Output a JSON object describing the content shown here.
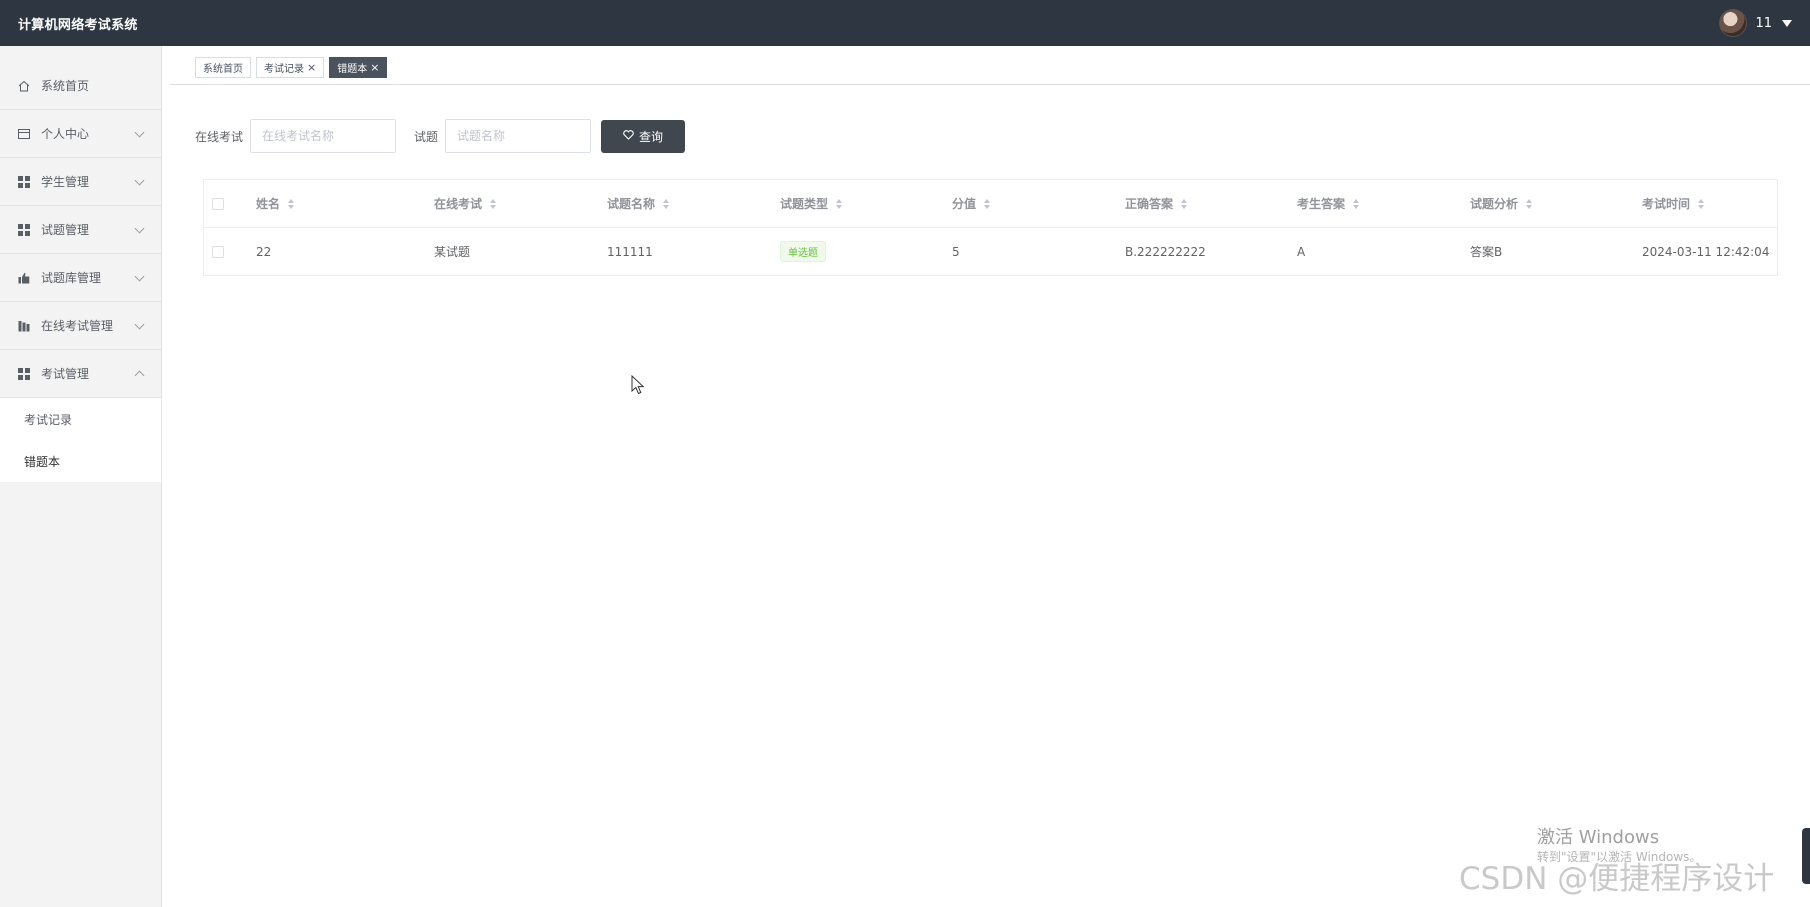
{
  "header": {
    "title": "计算机网络考试系统",
    "username": "11"
  },
  "sidebar": {
    "items": [
      {
        "label": "系统首页",
        "icon": "home-icon"
      },
      {
        "label": "个人中心",
        "icon": "card-icon",
        "expandable": true
      },
      {
        "label": "学生管理",
        "icon": "grid-icon",
        "expandable": true
      },
      {
        "label": "试题管理",
        "icon": "grid-icon",
        "expandable": true
      },
      {
        "label": "试题库管理",
        "icon": "thumb-icon",
        "expandable": true
      },
      {
        "label": "在线考试管理",
        "icon": "bars-icon",
        "expandable": true
      },
      {
        "label": "考试管理",
        "icon": "grid-icon",
        "expandable": true,
        "expanded": true
      }
    ],
    "submenu": [
      {
        "label": "考试记录"
      },
      {
        "label": "错题本",
        "active": true
      }
    ]
  },
  "tags": [
    {
      "label": "系统首页",
      "closable": false,
      "active": false
    },
    {
      "label": "考试记录",
      "closable": true,
      "active": false
    },
    {
      "label": "错题本",
      "closable": true,
      "active": true
    }
  ],
  "search": {
    "exam_label": "在线考试",
    "exam_placeholder": "在线考试名称",
    "exam_value": "",
    "question_label": "试题",
    "question_placeholder": "试题名称",
    "question_value": "",
    "query_button": "查询"
  },
  "table": {
    "columns": [
      "姓名",
      "在线考试",
      "试题名称",
      "试题类型",
      "分值",
      "正确答案",
      "考生答案",
      "试题分析",
      "考试时间"
    ],
    "rows": [
      {
        "name": "22",
        "exam": "某试题",
        "question": "111111",
        "type": "单选题",
        "score": "5",
        "correct": "B.222222222",
        "answer": "A",
        "analysis": "答案B",
        "time": "2024-03-11 12:42:04"
      }
    ]
  },
  "overlay": {
    "activate_title": "激活 Windows",
    "activate_sub": "转到\"设置\"以激活 Windows。",
    "csdn": "CSDN @便捷程序设计"
  },
  "colors": {
    "header_bg": "#2d3641",
    "button_bg": "#40474f",
    "badge_green": "#67c23a"
  }
}
